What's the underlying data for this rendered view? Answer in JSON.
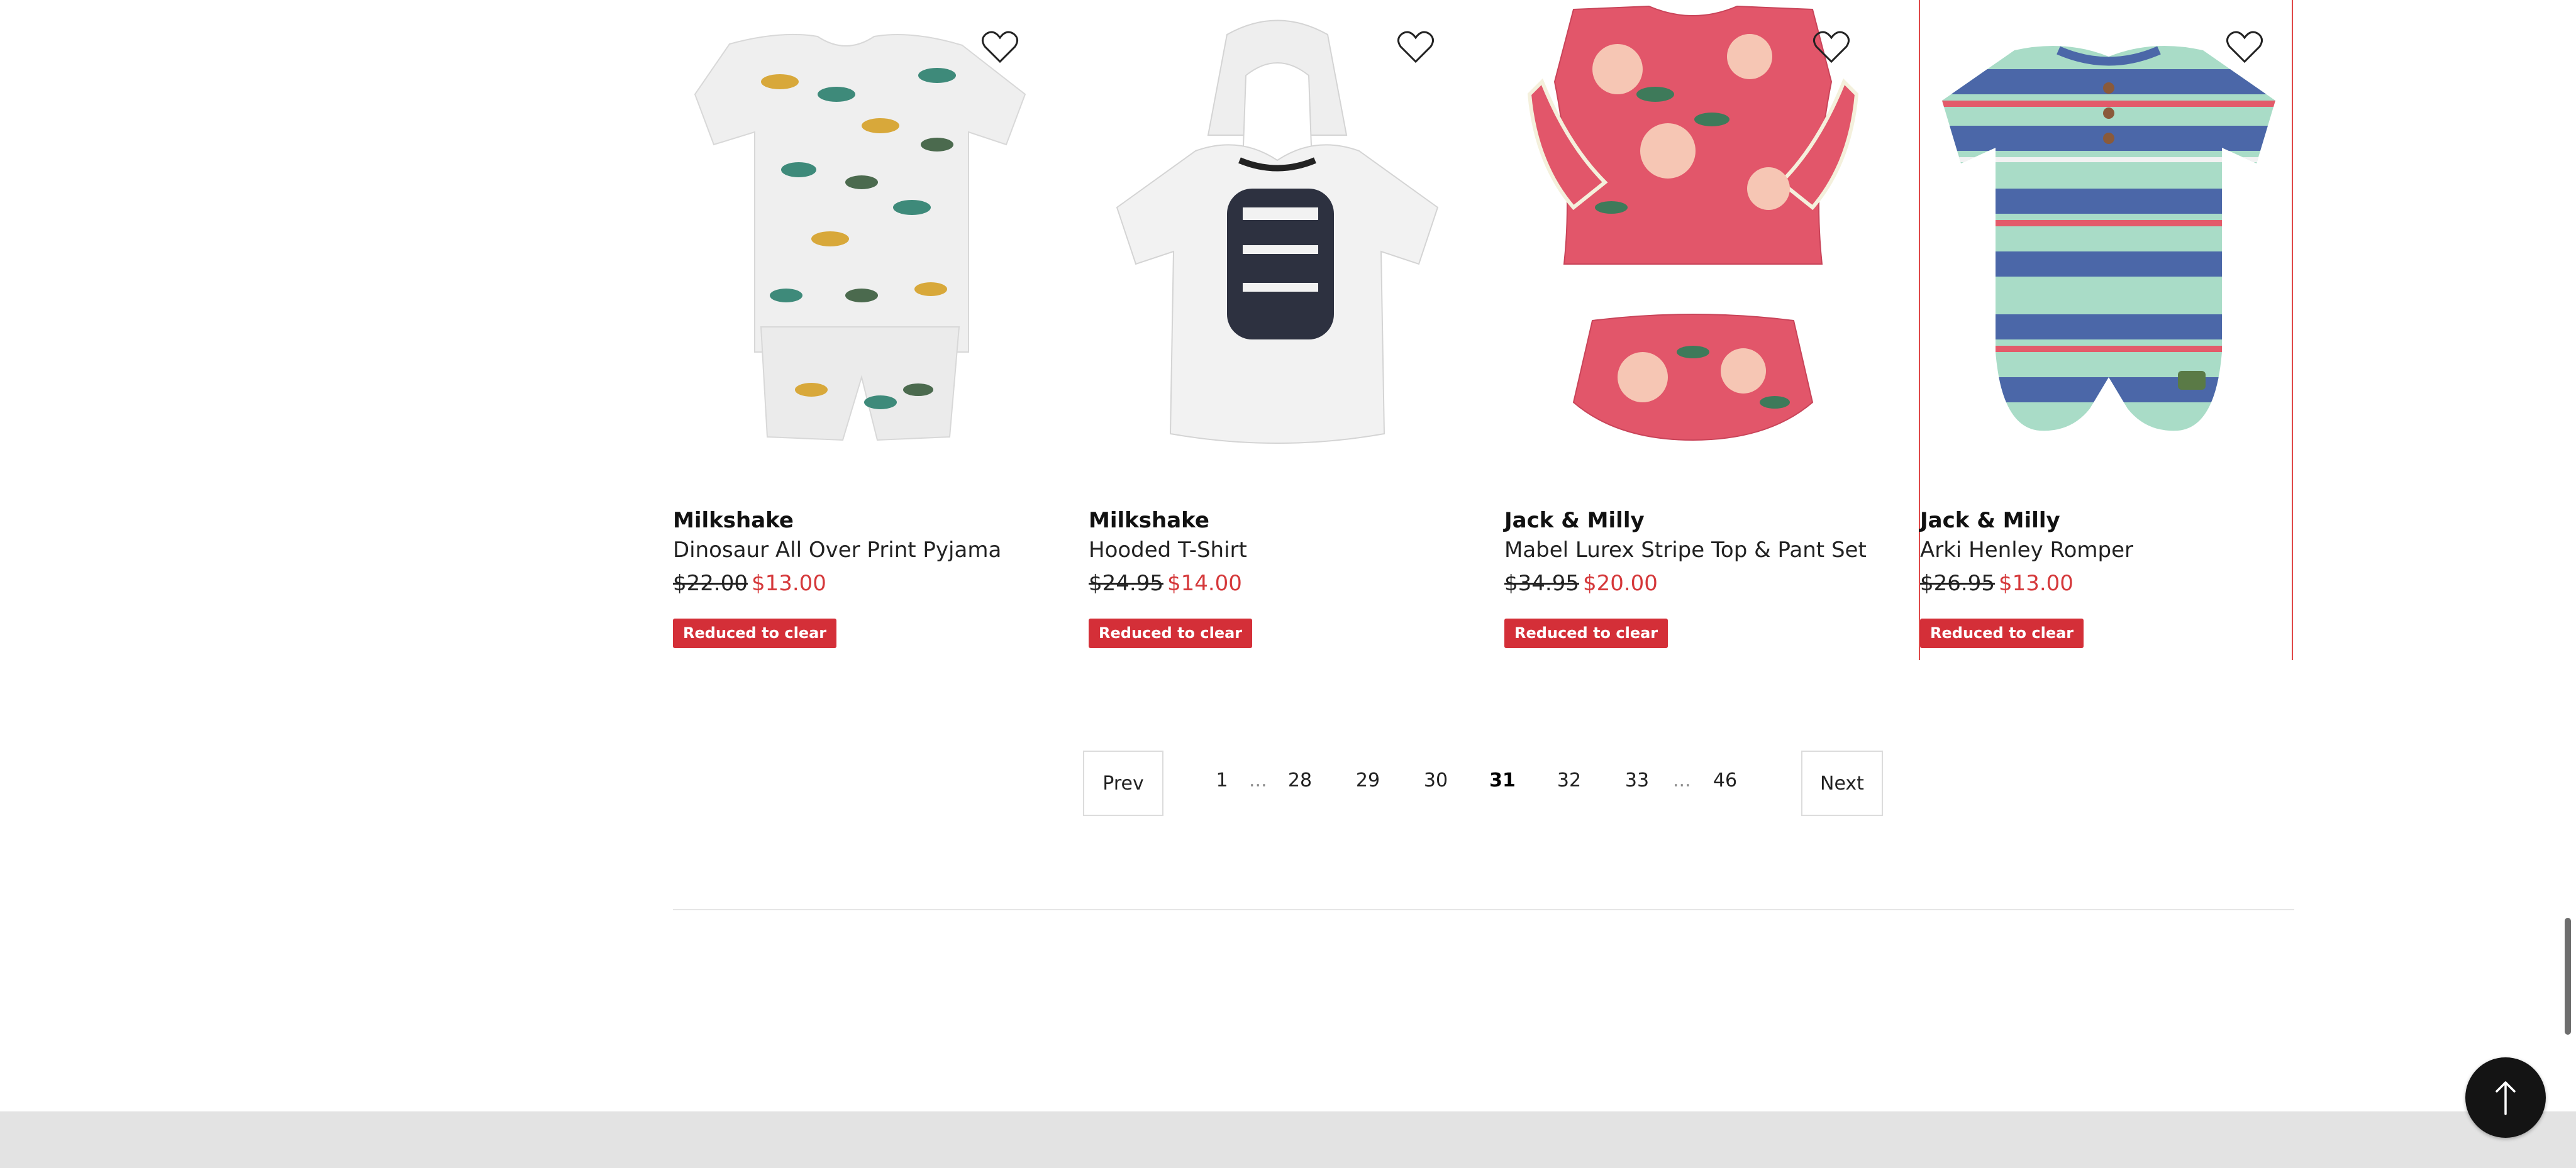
{
  "products": [
    {
      "brand": "Milkshake",
      "name": "Dinosaur All Over Print Pyjama",
      "old_price": "$22.00",
      "new_price": "$13.00",
      "badge": "Reduced to clear",
      "image": "dinosaur-pyjama-image"
    },
    {
      "brand": "Milkshake",
      "name": "Hooded T-Shirt",
      "old_price": "$24.95",
      "new_price": "$14.00",
      "badge": "Reduced to clear",
      "image": "hooded-tshirt-image"
    },
    {
      "brand": "Jack & Milly",
      "name": "Mabel Lurex Stripe Top & Pant Set",
      "old_price": "$34.95",
      "new_price": "$20.00",
      "badge": "Reduced to clear",
      "image": "floral-top-pant-set-image"
    },
    {
      "brand": "Jack & Milly",
      "name": "Arki Henley Romper",
      "old_price": "$26.95",
      "new_price": "$13.00",
      "badge": "Reduced to clear",
      "image": "striped-romper-image"
    }
  ],
  "pagination": {
    "prev": "Prev",
    "next": "Next",
    "pages": [
      "1",
      "28",
      "29",
      "30",
      "31",
      "32",
      "33",
      "46"
    ],
    "current": "31",
    "ellipsis": "..."
  },
  "icons": {
    "favorite": "heart-outline-icon",
    "back_to_top": "arrow-up-icon"
  },
  "colors": {
    "sale_price": "#d5383a",
    "badge_bg": "#d42f38",
    "back_to_top_bg": "#141414",
    "footer_bg": "#e3e3e3"
  }
}
